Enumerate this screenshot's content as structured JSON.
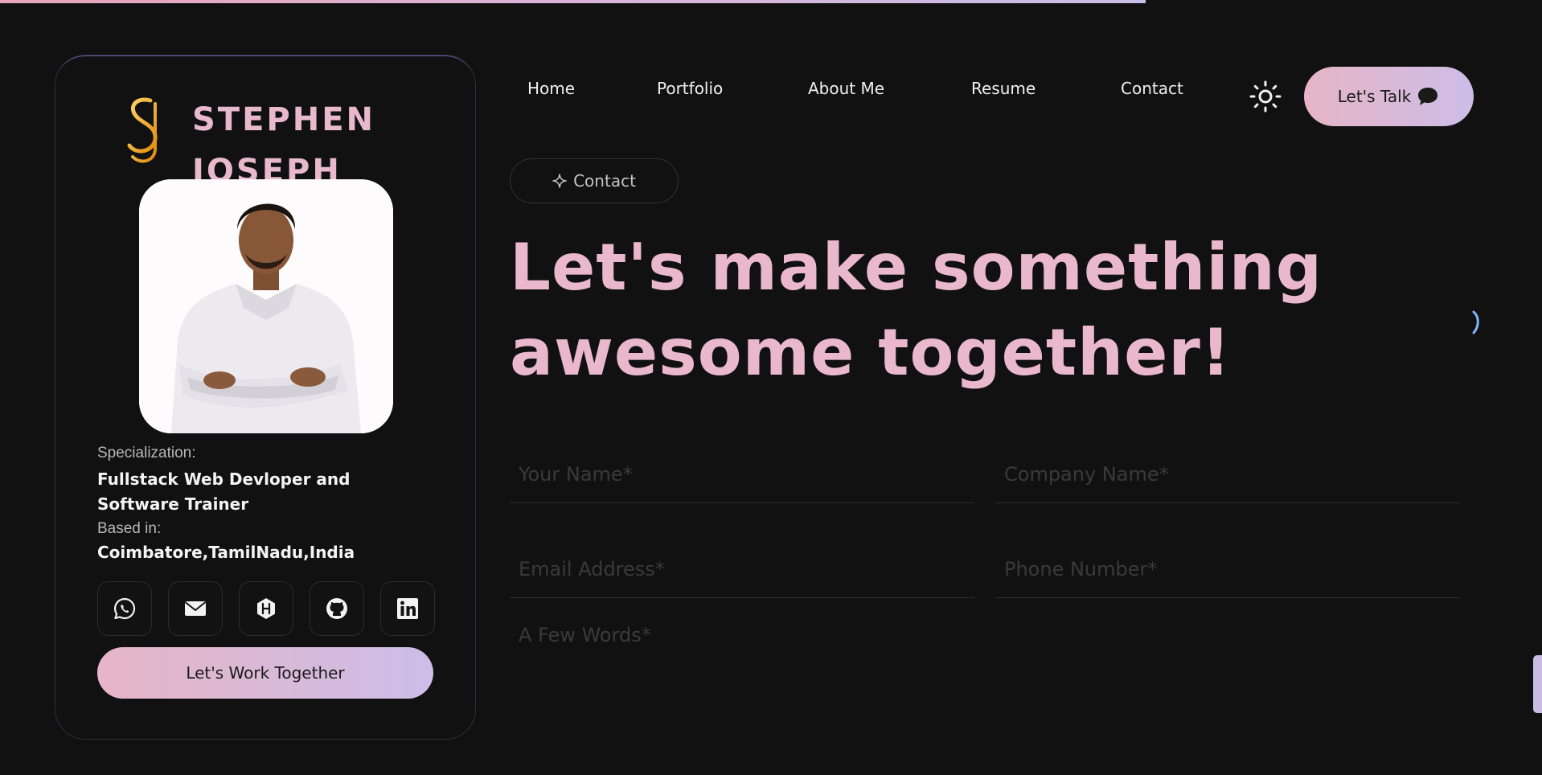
{
  "progress": {
    "fraction": 0.743
  },
  "brand": {
    "first_name": "STEPHEN",
    "last_name": "JOSEPH",
    "logo_icon": "sj-monogram-icon"
  },
  "profile": {
    "specialization_label": "Specialization:",
    "specialization_value": "Fullstack Web Devloper and Software Trainer",
    "based_label": "Based in:",
    "based_value": "Coimbatore,TamilNadu,India",
    "socials": [
      "whatsapp-icon",
      "mail-icon",
      "hashnode-icon",
      "github-icon",
      "linkedin-icon"
    ],
    "cta": "Let's Work Together"
  },
  "nav": {
    "items": [
      "Home",
      "Portfolio",
      "About Me",
      "Resume",
      "Contact"
    ],
    "theme_icon": "sun-icon",
    "talk_label": "Let's Talk",
    "talk_icon": "chat-bubble-icon"
  },
  "contact": {
    "pill_label": "Contact",
    "headline_line1": "Let's make something",
    "headline_line2": "awesome together!"
  },
  "form": {
    "name_placeholder": "Your Name*",
    "company_placeholder": "Company Name*",
    "email_placeholder": "Email Address*",
    "phone_placeholder": "Phone Number*",
    "message_placeholder": "A Few Words*"
  },
  "colors": {
    "background": "#111111",
    "accent_pink": "#e9b8cb",
    "accent_lavender": "#cdbde8",
    "logo_gold": "#f2a51b"
  }
}
